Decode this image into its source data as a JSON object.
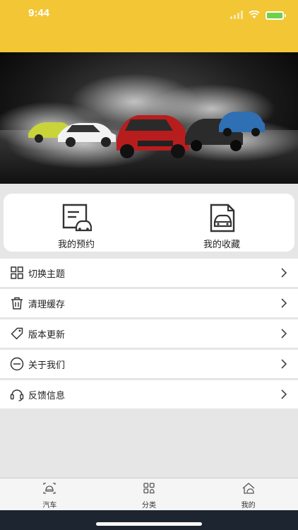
{
  "status": {
    "time": "9:44"
  },
  "quick": [
    {
      "label": "我的预约"
    },
    {
      "label": "我的收藏"
    }
  ],
  "menu": [
    {
      "label": "切换主题",
      "icon": "grid-icon"
    },
    {
      "label": "清理缓存",
      "icon": "trash-icon"
    },
    {
      "label": "版本更新",
      "icon": "tag-icon"
    },
    {
      "label": "关于我们",
      "icon": "minus-circle-icon"
    },
    {
      "label": "反馈信息",
      "icon": "headset-icon"
    }
  ],
  "tabs": [
    {
      "label": "汽车",
      "icon": "car-icon"
    },
    {
      "label": "分类",
      "icon": "category-icon"
    },
    {
      "label": "我的",
      "icon": "home-car-icon"
    }
  ],
  "colors": {
    "header": "#f2c635",
    "page_bg": "#e6e6e6"
  }
}
